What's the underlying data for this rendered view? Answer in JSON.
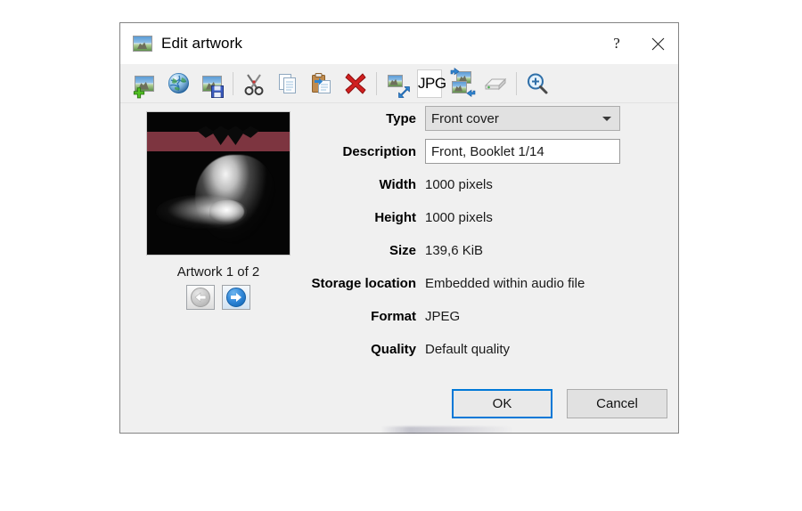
{
  "window": {
    "title": "Edit artwork",
    "icon": "picture-icon",
    "help_button": "?",
    "close_button": "✕"
  },
  "toolbar": {
    "items": [
      {
        "name": "add-artwork-icon",
        "tip": "Add artwork"
      },
      {
        "name": "download-artwork-icon",
        "tip": "Download artwork from web"
      },
      {
        "name": "save-artwork-icon",
        "tip": "Save artwork to file"
      },
      {
        "name": "cut-icon",
        "tip": "Cut"
      },
      {
        "name": "copy-icon",
        "tip": "Copy"
      },
      {
        "name": "paste-icon",
        "tip": "Paste"
      },
      {
        "name": "delete-icon",
        "tip": "Delete"
      },
      {
        "name": "resize-artwork-icon",
        "tip": "Resize artwork"
      },
      {
        "name": "convert-jpg-icon",
        "tip": "Convert to JPG",
        "label": "JPG"
      },
      {
        "name": "reorder-artwork-icon",
        "tip": "Reorder artwork"
      },
      {
        "name": "export-to-disk-icon",
        "tip": "Export to disk"
      },
      {
        "name": "zoom-icon",
        "tip": "Zoom"
      }
    ]
  },
  "artwork": {
    "caption": "Artwork 1 of 2",
    "prev_button": "previous-artwork",
    "next_button": "next-artwork",
    "prev_enabled": false,
    "next_enabled": true
  },
  "fields": [
    {
      "label": "Type",
      "value": "Front cover",
      "kind": "select"
    },
    {
      "label": "Description",
      "value": "Front, Booklet 1/14",
      "kind": "text"
    },
    {
      "label": "Width",
      "value": "1000 pixels",
      "kind": "static"
    },
    {
      "label": "Height",
      "value": "1000 pixels",
      "kind": "static"
    },
    {
      "label": "Size",
      "value": "139,6 KiB",
      "kind": "static"
    },
    {
      "label": "Storage location",
      "value": "Embedded within audio file",
      "kind": "static"
    },
    {
      "label": "Format",
      "value": "JPEG",
      "kind": "static"
    },
    {
      "label": "Quality",
      "value": "Default quality",
      "kind": "static"
    }
  ],
  "footer": {
    "ok_label": "OK",
    "cancel_label": "Cancel"
  },
  "colors": {
    "dialog_bg": "#f0f0f0",
    "titlebar_bg": "#ffffff",
    "accent": "#0078d7",
    "artwork_band": "#7d3540"
  }
}
